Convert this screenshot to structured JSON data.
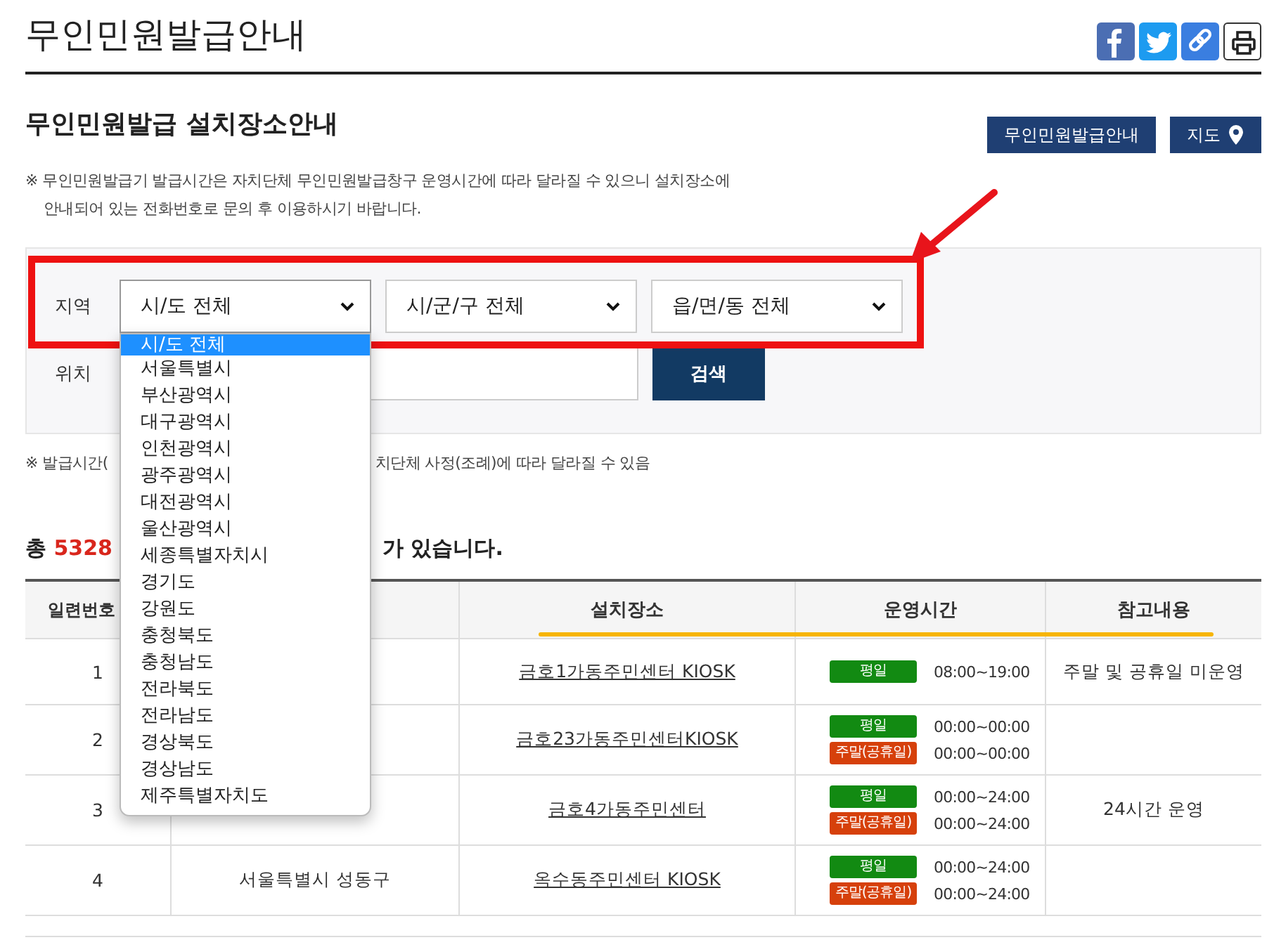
{
  "page_title": "무인민원발급안내",
  "share_buttons": [
    {
      "kind": "facebook"
    },
    {
      "kind": "twitter"
    },
    {
      "kind": "link"
    },
    {
      "kind": "print"
    }
  ],
  "section_title": "무인민원발급 설치장소안내",
  "header_buttons": [
    {
      "label": "무인민원발급안내",
      "kind": "plain"
    },
    {
      "label": "지도",
      "kind": "map"
    }
  ],
  "notice": [
    "※ 무인민원발급기 발급시간은 자치단체 무인민원발급창구 운영시간에 따라 달라질 수 있으니 설치장소에",
    "안내되어 있는 전화번호로 문의 후 이용하시기 바랍니다."
  ],
  "search": {
    "region_label": "지역",
    "selects": [
      {
        "value": "시/도 전체",
        "open": true
      },
      {
        "value": "시/군/구 전체",
        "open": false
      },
      {
        "value": "읍/면/동 전체",
        "open": false
      }
    ],
    "location_label": "위치",
    "search_button": "검색"
  },
  "dropdown_options": [
    {
      "label": "시/도 전체",
      "selected": true
    },
    {
      "label": "서울특별시",
      "selected": false
    },
    {
      "label": "부산광역시",
      "selected": false
    },
    {
      "label": "대구광역시",
      "selected": false
    },
    {
      "label": "인천광역시",
      "selected": false
    },
    {
      "label": "광주광역시",
      "selected": false
    },
    {
      "label": "대전광역시",
      "selected": false
    },
    {
      "label": "울산광역시",
      "selected": false
    },
    {
      "label": "세종특별자치시",
      "selected": false
    },
    {
      "label": "경기도",
      "selected": false
    },
    {
      "label": "강원도",
      "selected": false
    },
    {
      "label": "충청북도",
      "selected": false
    },
    {
      "label": "충청남도",
      "selected": false
    },
    {
      "label": "전라북도",
      "selected": false
    },
    {
      "label": "전라남도",
      "selected": false
    },
    {
      "label": "경상북도",
      "selected": false
    },
    {
      "label": "경상남도",
      "selected": false
    },
    {
      "label": "제주특별자치도",
      "selected": false
    }
  ],
  "hours_note": {
    "left": "※ 발급시간(",
    "right": "치단체 사정(조례)에 따라 달라질 수 있음"
  },
  "result_count": {
    "prefix": "총 ",
    "count": "5328",
    "suffix": "가 있습니다."
  },
  "table": {
    "columns": [
      "일련번호",
      "",
      "설치장소",
      "운영시간",
      "참고내용"
    ],
    "rows": [
      {
        "number": "1",
        "location": "금호1가동주민센터 KIOSK",
        "hours": [
          {
            "kind": "weekday",
            "label": "평일",
            "time": "08:00~19:00"
          }
        ],
        "note": "주말 및 공휴일 미운영"
      },
      {
        "number": "2",
        "location": "금호23가동주민센터KIOSK",
        "hours": [
          {
            "kind": "weekday",
            "label": "평일",
            "time": "00:00~00:00"
          },
          {
            "kind": "weekend",
            "label": "주말(공휴일)",
            "time": "00:00~00:00"
          }
        ]
      },
      {
        "number": "3",
        "location": "금호4가동주민센터",
        "hours": [
          {
            "kind": "weekday",
            "label": "평일",
            "time": "00:00~24:00"
          },
          {
            "kind": "weekend",
            "label": "주말(공휴일)",
            "time": "00:00~24:00"
          }
        ],
        "note": "24시간 운영"
      },
      {
        "number": "4",
        "district": "서울특별시 성동구",
        "location": "옥수동주민센터 KIOSK",
        "hours": [
          {
            "kind": "weekday",
            "label": "평일",
            "time": "00:00~24:00"
          },
          {
            "kind": "weekend",
            "label": "주말(공휴일)",
            "time": "00:00~24:00"
          }
        ]
      }
    ]
  }
}
